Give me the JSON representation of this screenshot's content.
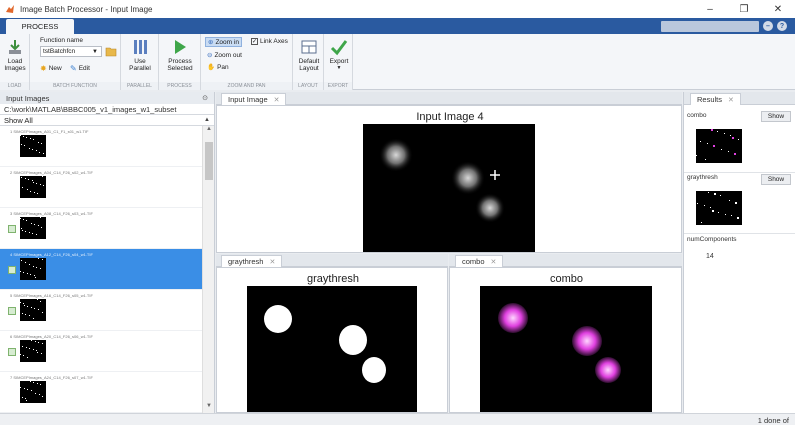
{
  "window": {
    "title": "Image Batch Processor - Input Image",
    "controls": [
      "–",
      "❐",
      "✕"
    ]
  },
  "tabstrip": {
    "active_tab": "PROCESS"
  },
  "toolstrip": {
    "load_images": "Load\nImages",
    "function_name_label": "Function name",
    "function_name_value": "tstBatchfcn",
    "new_label": "New",
    "edit_label": "Edit",
    "use_parallel": "Use\nParallel",
    "process_selected": "Process\nSelected",
    "zoom_in": "Zoom in",
    "zoom_out": "Zoom out",
    "pan": "Pan",
    "link_axes": "Link Axes",
    "default_layout": "Default\nLayout",
    "export": "Export",
    "section_labels": [
      "LOAD",
      "BATCH FUNCTION",
      "PARALLEL",
      "PROCESS",
      "ZOOM AND PAN",
      "LAYOUT",
      "EXPORT"
    ]
  },
  "input_images": {
    "header": "Input Images",
    "path": "C:\\work\\MATLAB\\BBBC005_v1_images_w1_subset",
    "filter": "Show All",
    "items": [
      {
        "name": "1 SIMCEPImages_A01_C1_F1_s01_w1.TIF",
        "checked": false,
        "selected": false
      },
      {
        "name": "2 SIMCEPImages_A04_C14_F26_s02_w1.TIF",
        "checked": false,
        "selected": false
      },
      {
        "name": "3 SIMCEPImages_A08_C14_F26_s03_w1.TIF",
        "checked": true,
        "selected": false
      },
      {
        "name": "4 SIMCEPImages_A12_C14_F26_s04_w1.TIF",
        "checked": true,
        "selected": true
      },
      {
        "name": "5 SIMCEPImages_A16_C14_F26_s05_w1.TIF",
        "checked": true,
        "selected": false
      },
      {
        "name": "6 SIMCEPImages_A20_C14_F26_s06_w1.TIF",
        "checked": true,
        "selected": false
      },
      {
        "name": "7 SIMCEPImages_A24_C14_F26_s07_w1.TIF",
        "checked": false,
        "selected": false
      }
    ]
  },
  "input_image_panel": {
    "tab": "Input Image",
    "title": "Input Image 4"
  },
  "graythresh_panel": {
    "tab": "graythresh",
    "title": "graythresh"
  },
  "combo_panel": {
    "tab": "combo",
    "title": "combo"
  },
  "results": {
    "tab": "Results",
    "combo_label": "combo",
    "graythresh_label": "graythresh",
    "show_label": "Show",
    "num_components_label": "numComponents",
    "num_components_value": "14"
  },
  "status": {
    "text": "1 done of"
  },
  "colors": {
    "accent": "#2a5aa0",
    "selection": "#3a8ee6",
    "combo_blob": "#e040e0"
  }
}
